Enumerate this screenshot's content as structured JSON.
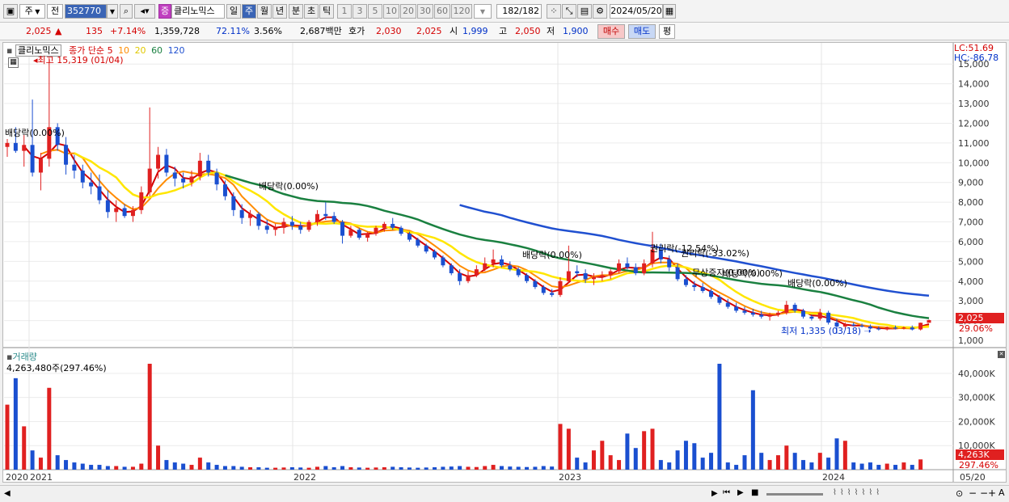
{
  "toolbar": {
    "period_main": "주",
    "prev_label": "전",
    "code": "352770",
    "stock_badge": "증",
    "stock_name": "클리노믹스",
    "periods": [
      "일",
      "주",
      "월",
      "년",
      "분",
      "초",
      "틱"
    ],
    "selected_period": "주",
    "intervals": [
      "1",
      "3",
      "5",
      "10",
      "20",
      "30",
      "60",
      "120"
    ],
    "count_display": "182",
    "count_total": "/182",
    "date": "2024/05/20"
  },
  "quote": {
    "price": "2,025",
    "arrow": "▲",
    "change": "135",
    "change_pct": "+7.14%",
    "volume": "1,359,728",
    "volume_ratio": "72.11%",
    "turnover": "3.56%",
    "trade_value": "2,687백만",
    "bid_label": "호가",
    "ask_price": "2,030",
    "bid_price": "2,025",
    "open_label": "시",
    "open": "1,999",
    "high_label": "고",
    "high": "2,050",
    "low_label": "저",
    "low": "1,900",
    "buy_button": "매수",
    "sell_button": "매도",
    "eval_button": "평"
  },
  "chart": {
    "stock_tag": "클리노믹스",
    "ma_legend_prefix": "종가 단순",
    "ma_periods": [
      {
        "label": "5",
        "color": "#d40000"
      },
      {
        "label": "10",
        "color": "#ff8c00"
      },
      {
        "label": "20",
        "color": "#e8d800"
      },
      {
        "label": "60",
        "color": "#1a8040"
      },
      {
        "label": "120",
        "color": "#2050d0"
      }
    ],
    "lc": "LC:51.69",
    "hc": "HC:-86.78",
    "high_marker": "최고 15,319 (01/04)",
    "low_marker": "최저 1,335 (03/18)",
    "price_axis": [
      "15,000",
      "14,000",
      "13,000",
      "12,000",
      "11,000",
      "10,000",
      "9,000",
      "8,000",
      "7,000",
      "6,000",
      "5,000",
      "4,000",
      "3,000",
      "2,000",
      "1,000"
    ],
    "current_price_tag": "2,025",
    "current_pct_tag": "29.06%",
    "annotations": [
      "배당락(0.00%)",
      "배당락(0.00%)",
      "배당락(0.00%)",
      "권리락(-12.54%)",
      "권리락(-33.02%)",
      "무상증자(0.00%)",
      "배당락(0.00%)",
      "배당락(0.00%)"
    ],
    "volume_title": "거래량",
    "volume_info": "4,263,480주(297.46%)",
    "volume_axis": [
      "40,000K",
      "30,000K",
      "20,000K",
      "10,000K"
    ],
    "volume_tag": "4,263K",
    "volume_pct_tag": "297.46%",
    "x_labels": [
      "2020",
      "2021",
      "2022",
      "2023",
      "2024",
      "05/20"
    ]
  },
  "chart_data": {
    "type": "candlestick",
    "price_series": [
      [
        10800,
        11200,
        10300,
        11000
      ],
      [
        11000,
        11800,
        10500,
        10600
      ],
      [
        10600,
        11400,
        9800,
        10900
      ],
      [
        10900,
        13200,
        9300,
        9500
      ],
      [
        9500,
        10500,
        8600,
        10200
      ],
      [
        10200,
        15319,
        9800,
        11800
      ],
      [
        11800,
        12000,
        10600,
        10900
      ],
      [
        10900,
        11300,
        9400,
        9900
      ],
      [
        9900,
        10400,
        9200,
        9600
      ],
      [
        9600,
        9900,
        8700,
        9000
      ],
      [
        9000,
        9500,
        8400,
        8800
      ],
      [
        8800,
        9400,
        7900,
        8100
      ],
      [
        8100,
        8600,
        7200,
        7500
      ],
      [
        7500,
        8100,
        7000,
        7700
      ],
      [
        7700,
        7900,
        7200,
        7300
      ],
      [
        7300,
        7800,
        7000,
        7600
      ],
      [
        7600,
        8800,
        7400,
        8500
      ],
      [
        8500,
        12800,
        8300,
        9700
      ],
      [
        9700,
        10800,
        9200,
        10400
      ],
      [
        10400,
        10700,
        9300,
        9500
      ],
      [
        9500,
        9800,
        8800,
        9200
      ],
      [
        9200,
        9500,
        8700,
        9000
      ],
      [
        9000,
        9600,
        8800,
        9300
      ],
      [
        9300,
        10500,
        9100,
        10100
      ],
      [
        10100,
        10400,
        9300,
        9500
      ],
      [
        9500,
        9700,
        8600,
        8900
      ],
      [
        8900,
        9100,
        8100,
        8300
      ],
      [
        8300,
        8500,
        7300,
        7600
      ],
      [
        7600,
        7900,
        6900,
        7200
      ],
      [
        7200,
        7600,
        6800,
        7400
      ],
      [
        7400,
        7500,
        6600,
        6800
      ],
      [
        6800,
        7100,
        6400,
        6600
      ],
      [
        6600,
        6900,
        6300,
        6700
      ],
      [
        6700,
        7200,
        6400,
        7000
      ],
      [
        7000,
        7300,
        6600,
        6800
      ],
      [
        6800,
        7000,
        6400,
        6600
      ],
      [
        6600,
        7100,
        6500,
        7000
      ],
      [
        7000,
        7600,
        6800,
        7400
      ],
      [
        7400,
        8000,
        7100,
        7300
      ],
      [
        7300,
        7500,
        6900,
        7000
      ],
      [
        7000,
        7100,
        5900,
        6300
      ],
      [
        6300,
        6800,
        6200,
        6600
      ],
      [
        6600,
        6700,
        6100,
        6200
      ],
      [
        6200,
        6500,
        6000,
        6400
      ],
      [
        6400,
        6800,
        6300,
        6700
      ],
      [
        6700,
        7000,
        6500,
        6900
      ],
      [
        6900,
        7200,
        6600,
        6700
      ],
      [
        6700,
        6800,
        6300,
        6400
      ],
      [
        6400,
        6500,
        6000,
        6100
      ],
      [
        6100,
        6200,
        5700,
        5800
      ],
      [
        5800,
        5900,
        5400,
        5500
      ],
      [
        5500,
        5600,
        5100,
        5200
      ],
      [
        5200,
        5300,
        4700,
        4800
      ],
      [
        4800,
        4900,
        4300,
        4400
      ],
      [
        4400,
        4600,
        3800,
        4000
      ],
      [
        4000,
        4500,
        3900,
        4300
      ],
      [
        4300,
        4800,
        4200,
        4600
      ],
      [
        4600,
        5200,
        4500,
        4900
      ],
      [
        4900,
        5600,
        4700,
        5100
      ],
      [
        5100,
        5300,
        4700,
        4800
      ],
      [
        4800,
        5000,
        4500,
        4600
      ],
      [
        4600,
        4700,
        4200,
        4300
      ],
      [
        4300,
        4400,
        3900,
        4000
      ],
      [
        4000,
        4100,
        3600,
        3700
      ],
      [
        3700,
        3800,
        3300,
        3400
      ],
      [
        3400,
        3600,
        3200,
        3300
      ],
      [
        3300,
        4200,
        3200,
        4000
      ],
      [
        4000,
        5800,
        3900,
        4500
      ],
      [
        4500,
        4800,
        4200,
        4400
      ],
      [
        4400,
        4600,
        3900,
        4100
      ],
      [
        4100,
        4400,
        3800,
        4200
      ],
      [
        4200,
        4500,
        4000,
        4300
      ],
      [
        4300,
        4600,
        4100,
        4500
      ],
      [
        4500,
        5100,
        4400,
        4900
      ],
      [
        4900,
        5200,
        4600,
        4700
      ],
      [
        4700,
        4900,
        4300,
        4400
      ],
      [
        4400,
        5100,
        4300,
        4900
      ],
      [
        4900,
        6500,
        4700,
        5600
      ],
      [
        5600,
        5900,
        4900,
        5100
      ],
      [
        5100,
        5300,
        4500,
        4700
      ],
      [
        4700,
        4900,
        4000,
        4100
      ],
      [
        4100,
        4300,
        3700,
        3800
      ],
      [
        3800,
        4000,
        3500,
        3700
      ],
      [
        3700,
        3900,
        3400,
        3500
      ],
      [
        3500,
        3600,
        3100,
        3200
      ],
      [
        3200,
        3300,
        2800,
        2900
      ],
      [
        2900,
        3100,
        2600,
        2700
      ],
      [
        2700,
        2900,
        2400,
        2500
      ],
      [
        2500,
        2700,
        2300,
        2400
      ],
      [
        2400,
        2600,
        2200,
        2300
      ],
      [
        2300,
        2500,
        2100,
        2200
      ],
      [
        2200,
        2400,
        2000,
        2300
      ],
      [
        2300,
        2500,
        2200,
        2400
      ],
      [
        2400,
        3000,
        2300,
        2800
      ],
      [
        2800,
        2900,
        2400,
        2500
      ],
      [
        2500,
        2600,
        2100,
        2200
      ],
      [
        2200,
        2300,
        2000,
        2100
      ],
      [
        2100,
        2600,
        2000,
        2400
      ],
      [
        2400,
        2500,
        1800,
        1900
      ],
      [
        1900,
        2100,
        1335,
        1700
      ],
      [
        1700,
        1900,
        1600,
        1800
      ],
      [
        1800,
        1900,
        1700,
        1750
      ],
      [
        1750,
        1850,
        1650,
        1700
      ],
      [
        1700,
        1800,
        1550,
        1600
      ],
      [
        1600,
        1700,
        1500,
        1550
      ],
      [
        1550,
        1700,
        1500,
        1650
      ],
      [
        1650,
        1750,
        1550,
        1600
      ],
      [
        1600,
        1700,
        1550,
        1650
      ],
      [
        1650,
        1750,
        1500,
        1550
      ],
      [
        1550,
        1900,
        1500,
        1890
      ],
      [
        1890,
        2050,
        1900,
        2025
      ]
    ],
    "volume_k": [
      27000,
      38000,
      18000,
      8000,
      5000,
      34000,
      6000,
      4000,
      3000,
      2500,
      2000,
      2000,
      1500,
      1500,
      1200,
      1200,
      2500,
      44000,
      10000,
      4000,
      3000,
      2500,
      2000,
      5000,
      3000,
      2000,
      1500,
      1500,
      1200,
      1000,
      1000,
      800,
      800,
      900,
      1000,
      900,
      800,
      1200,
      1500,
      1000,
      1500,
      1000,
      900,
      800,
      900,
      1000,
      1200,
      1000,
      900,
      800,
      900,
      1000,
      1200,
      1300,
      1500,
      1200,
      1100,
      1500,
      2000,
      1500,
      1300,
      1200,
      1100,
      1200,
      1500,
      1300,
      19000,
      17000,
      5000,
      3000,
      8000,
      12000,
      6000,
      4000,
      15000,
      9000,
      16000,
      17000,
      4000,
      3000,
      8000,
      12000,
      11000,
      5000,
      7000,
      44000,
      3000,
      2000,
      6000,
      33000,
      7000,
      4000,
      6000,
      10000,
      7000,
      4000,
      3000,
      7000,
      5000,
      13000,
      12000,
      3000,
      2500,
      3000,
      2000,
      2500,
      2000,
      3000,
      2000,
      4263
    ],
    "ylim": [
      1000,
      15319
    ],
    "volume_ylim": [
      0,
      45000
    ]
  }
}
